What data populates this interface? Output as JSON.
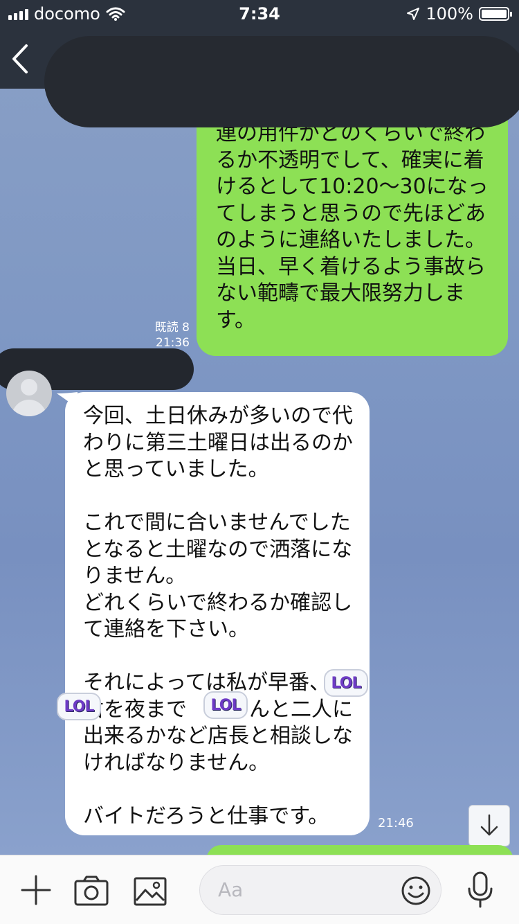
{
  "status_bar": {
    "carrier": "docomo",
    "time": "7:34",
    "battery": "100%"
  },
  "messages": {
    "outgoing": {
      "text": "連の用件がどのくらいで終わるか不透明でして、確実に着けるとして10:20〜30になってしまうと思うので先ほどあのように連絡いたしました。当日、早く着けるよう事故らない範疇で最大限努力します。",
      "read_label": "既読 8",
      "time": "21:36"
    },
    "incoming": {
      "text": "今回、土日休みが多いので代わりに第三土曜日は出るのかと思っていました。\n\nこれで間に合いませんでしたとなると土曜なので洒落になりません。\nどれくらいで終わるか確認して連絡を下さい。\n\nそれによっては私が早番、　君を夜まで　　さんと二人に出来るかなど店長と相談しなければなりません。\n\nバイトだろうと仕事です。",
      "time": "21:46"
    },
    "stickers": [
      "LOL",
      "LOL",
      "LOL"
    ]
  },
  "input": {
    "placeholder": "Aa"
  },
  "colors": {
    "header_bg": "#2b323d",
    "outgoing_bubble": "#8de055",
    "incoming_bubble": "#ffffff",
    "chat_bg": "#7f98c4"
  }
}
